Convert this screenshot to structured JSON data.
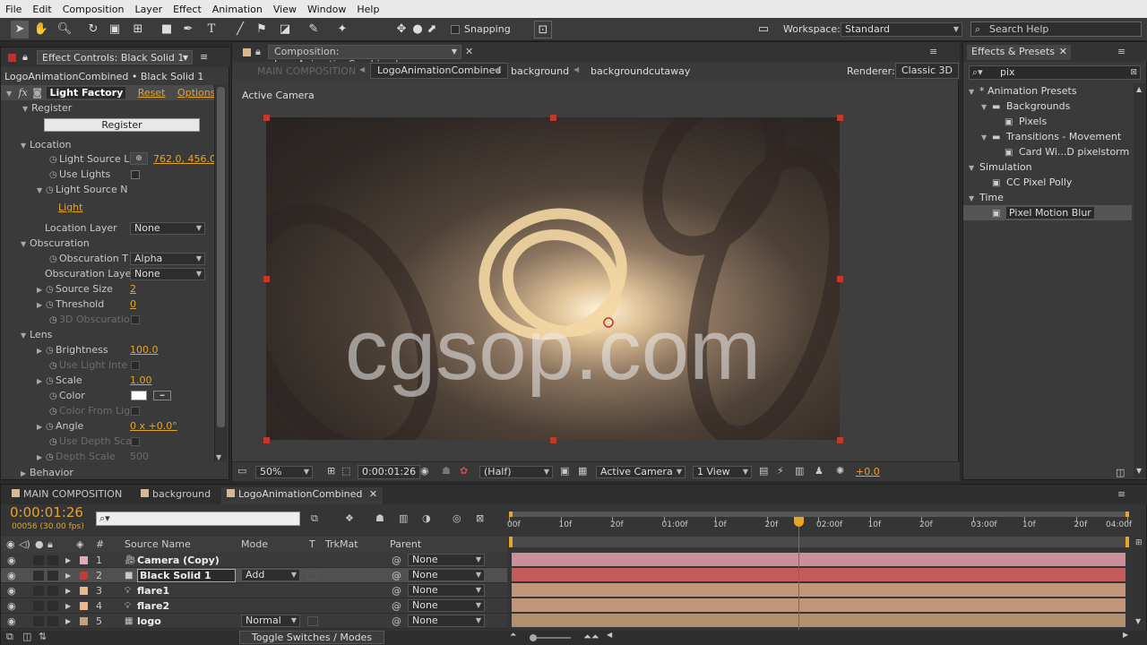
{
  "menu": [
    "File",
    "Edit",
    "Composition",
    "Layer",
    "Effect",
    "Animation",
    "View",
    "Window",
    "Help"
  ],
  "toolbar": {
    "snapping_label": "Snapping",
    "workspace_label": "Workspace:",
    "workspace_value": "Standard",
    "search_placeholder": "Search Help"
  },
  "effect_controls": {
    "tab_title": "Effect Controls: Black Solid 1",
    "subtitle": "LogoAnimationCombined • Black Solid 1",
    "fx_label": "fx",
    "effect_name": "Light Factory",
    "reset": "Reset",
    "options": "Options...",
    "register_label": "Register",
    "register_button": "Register",
    "location": "Location",
    "light_source_l": "Light Source L",
    "light_source_l_value": "762.0, 456.0",
    "use_lights": "Use Lights",
    "light_source_n": "Light Source N",
    "light": "Light",
    "location_layer": "Location Layer",
    "location_layer_value": "None",
    "obscuration": "Obscuration",
    "obscuration_t": "Obscuration T",
    "obscuration_t_value": "Alpha",
    "obscuration_layer": "Obscuration Layer",
    "obscuration_layer_value": "None",
    "source_size": "Source Size",
    "source_size_value": "2",
    "threshold": "Threshold",
    "threshold_value": "0",
    "obscuration_3d": "3D Obscuratio",
    "lens": "Lens",
    "brightness": "Brightness",
    "brightness_value": "100.0",
    "use_light_inte": "Use Light Inte",
    "scale": "Scale",
    "scale_value": "1.00",
    "color": "Color",
    "color_from_lig": "Color From Lig",
    "angle": "Angle",
    "angle_value": "0 x +0.0°",
    "use_depth_sca": "Use Depth Sca",
    "depth_scale": "Depth Scale",
    "depth_scale_value": "500",
    "behavior": "Behavior"
  },
  "composition": {
    "tab_title": "Composition: LogoAnimationCombined",
    "crumbs": [
      "MAIN COMPOSITION",
      "LogoAnimationCombined",
      "background",
      "backgroundcutaway"
    ],
    "renderer_label": "Renderer:",
    "renderer_value": "Classic 3D",
    "camera_label": "Active Camera",
    "watermark": "cgsop.com",
    "zoom": "50%",
    "timecode": "0:00:01:26",
    "resolution": "(Half)",
    "view_camera": "Active Camera",
    "views": "1 View",
    "exposure": "+0.0"
  },
  "effects_presets": {
    "tab_title": "Effects & Presets",
    "search_value": "pix",
    "items": [
      {
        "label": "* Animation Presets",
        "indent": 0,
        "type": "group"
      },
      {
        "label": "Backgrounds",
        "indent": 1,
        "type": "folder"
      },
      {
        "label": "Pixels",
        "indent": 2,
        "type": "preset"
      },
      {
        "label": "Transitions - Movement",
        "indent": 1,
        "type": "folder"
      },
      {
        "label": "Card Wi...D pixelstorm",
        "indent": 2,
        "type": "preset"
      },
      {
        "label": "Simulation",
        "indent": 0,
        "type": "group"
      },
      {
        "label": "CC Pixel Polly",
        "indent": 1,
        "type": "effect"
      },
      {
        "label": "Time",
        "indent": 0,
        "type": "group"
      },
      {
        "label": "Pixel Motion Blur",
        "indent": 1,
        "type": "effect",
        "selected": true
      }
    ]
  },
  "timeline": {
    "tabs": [
      "MAIN COMPOSITION",
      "background",
      "LogoAnimationCombined"
    ],
    "timecode": "0:00:01:26",
    "frame_info": "00056 (30.00 fps)",
    "headers": {
      "source_name": "Source Name",
      "mode": "Mode",
      "t": "T",
      "trkmat": "TrkMat",
      "parent": "Parent",
      "num": "#"
    },
    "ruler": [
      "00f",
      "10f",
      "20f",
      "01:00f",
      "10f",
      "20f",
      "02:00f",
      "10f",
      "20f",
      "03:00f",
      "10f",
      "20f",
      "04:00f"
    ],
    "layers": [
      {
        "num": "1",
        "name": "Camera (Copy)",
        "mode": "",
        "parent": "None",
        "label_color": "#e8a8b8",
        "bar_color": "#c98f9b",
        "icon": "camera-icon"
      },
      {
        "num": "2",
        "name": "Black Solid 1",
        "mode": "Add",
        "parent": "None",
        "label_color": "#c23a3a",
        "bar_color": "#c45a5a",
        "icon": "solid-icon",
        "selected": true
      },
      {
        "num": "3",
        "name": "flare1",
        "mode": "",
        "parent": "None",
        "label_color": "#e8b88a",
        "bar_color": "#c0957a",
        "icon": "light-icon"
      },
      {
        "num": "4",
        "name": "flare2",
        "mode": "",
        "parent": "None",
        "label_color": "#e8b88a",
        "bar_color": "#c0957a",
        "icon": "light-icon"
      },
      {
        "num": "5",
        "name": "logo",
        "mode": "Normal",
        "parent": "None",
        "label_color": "#c9a070",
        "bar_color": "#b2906f",
        "icon": "comp-icon"
      }
    ],
    "toggle_label": "Toggle Switches / Modes",
    "playhead_fraction": 0.468
  }
}
